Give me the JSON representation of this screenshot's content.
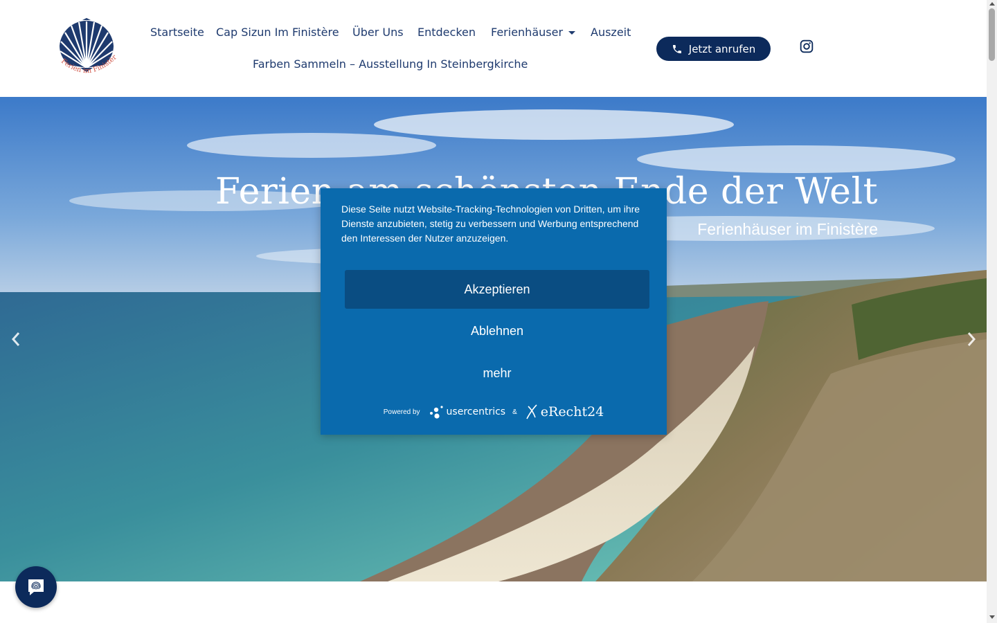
{
  "header": {
    "logo_alt": "Ferien im Finistère",
    "nav": [
      {
        "label": "Startseite"
      },
      {
        "label": "Cap Sizun Im Finistère"
      },
      {
        "label": "Über Uns"
      },
      {
        "label": "Entdecken"
      },
      {
        "label": "Ferienhäuser"
      },
      {
        "label": "Auszeit"
      },
      {
        "label": "Farben Sammeln – Ausstellung In Steinbergkirche"
      }
    ],
    "call_button": "Jetzt anrufen"
  },
  "hero": {
    "title": "Ferien am schönsten Ende der Welt",
    "subtitle": "Ferienhäuser im Finistère"
  },
  "consent": {
    "text": "Diese Seite nutzt Website-Tracking-Technologien von Dritten, um ihre Dienste anzubieten, stetig zu verbessern und Werbung entsprechend den Interessen der Nutzer anzuzeigen.",
    "accept": "Akzeptieren",
    "decline": "Ablehnen",
    "more": "mehr",
    "powered_by": "Powered by",
    "brand1": "usercentrics",
    "amp": "&",
    "brand2": "eRecht24"
  },
  "colors": {
    "nav_text": "#1e3a6e",
    "button_dark": "#0c2a5b",
    "modal_bg": "#0a6aad",
    "accept_bg": "#0a4d82"
  }
}
